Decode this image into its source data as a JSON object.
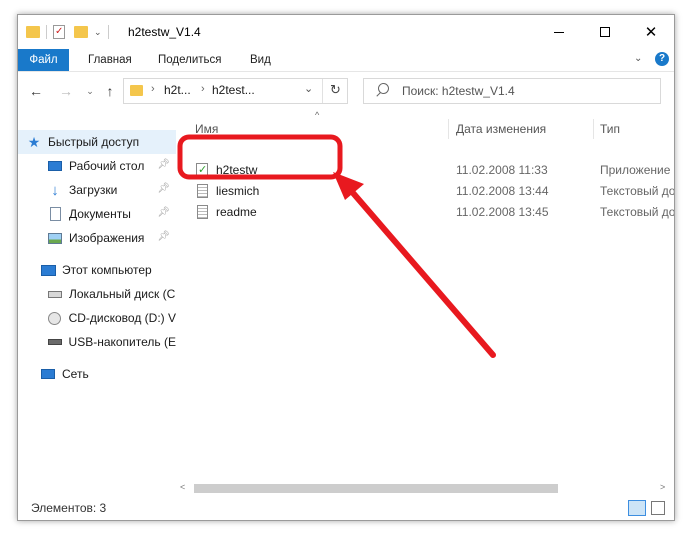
{
  "window": {
    "title": "h2testw_V1.4"
  },
  "ribbon": {
    "tabs": [
      "Файл",
      "Главная",
      "Поделиться",
      "Вид"
    ]
  },
  "address": {
    "segments": [
      "h2t...",
      "h2test..."
    ]
  },
  "search": {
    "placeholder": "Поиск: h2testw_V1.4"
  },
  "sidebar": {
    "quick_access": "Быстрый доступ",
    "items": [
      {
        "label": "Рабочий стол",
        "icon": "desktop-icon",
        "pinned": true
      },
      {
        "label": "Загрузки",
        "icon": "downloads-icon",
        "pinned": true
      },
      {
        "label": "Документы",
        "icon": "documents-icon",
        "pinned": true
      },
      {
        "label": "Изображения",
        "icon": "pictures-icon",
        "pinned": true
      }
    ],
    "this_pc": "Этот компьютер",
    "drives": [
      {
        "label": "Локальный диск (С",
        "icon": "local-disk-icon"
      },
      {
        "label": "CD-дисковод (D:) V",
        "icon": "cd-drive-icon"
      },
      {
        "label": "USB-накопитель (E",
        "icon": "usb-drive-icon"
      }
    ],
    "network": "Сеть"
  },
  "columns": {
    "name": "Имя",
    "date": "Дата изменения",
    "type": "Тип"
  },
  "files": [
    {
      "name": "h2testw",
      "date": "11.02.2008 11:33",
      "type": "Приложение",
      "icon": "application-icon",
      "highlighted": true
    },
    {
      "name": "liesmich",
      "date": "11.02.2008 13:44",
      "type": "Текстовый до",
      "icon": "text-file-icon"
    },
    {
      "name": "readme",
      "date": "11.02.2008 13:45",
      "type": "Текстовый до",
      "icon": "text-file-icon"
    }
  ],
  "status": {
    "items_count": "Элементов: 3"
  },
  "colors": {
    "accent": "#1979ca",
    "annotation": "#e8191f",
    "selection": "#e5f1fb"
  }
}
